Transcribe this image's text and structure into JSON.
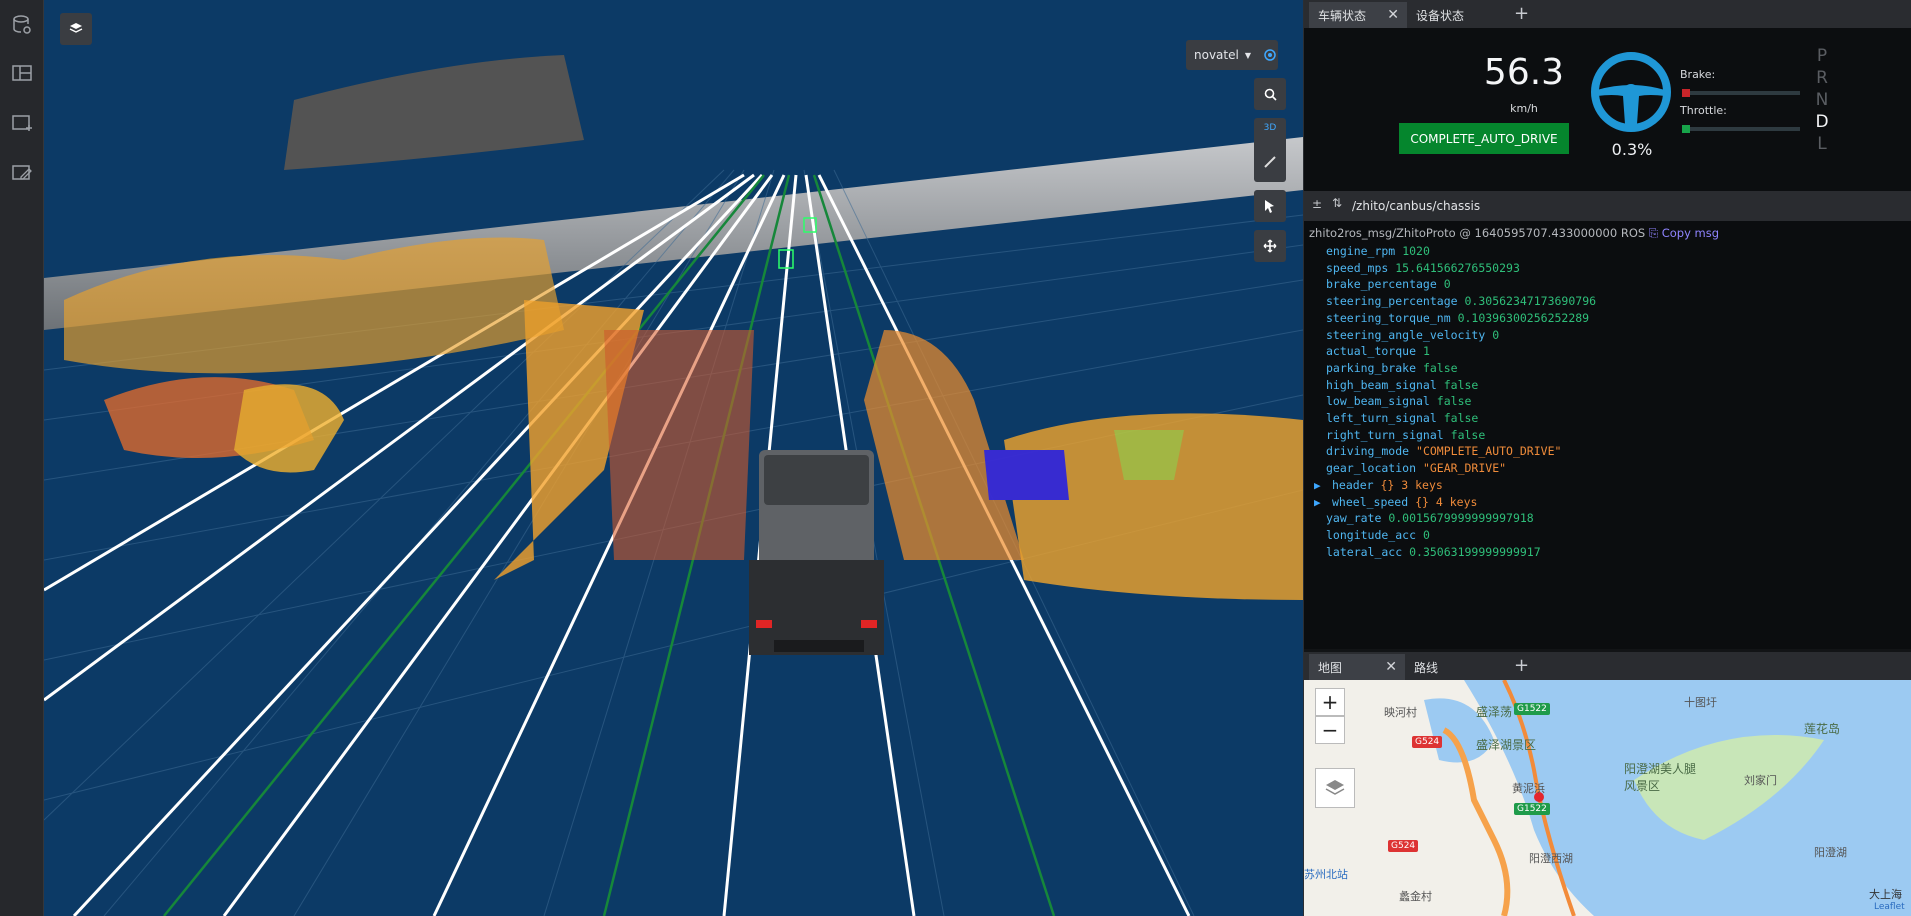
{
  "viewport": {
    "frame_select": "novatel",
    "view_mode_label": "3D"
  },
  "right_top_tabs": [
    {
      "label": "车辆状态"
    },
    {
      "label": "设备状态"
    }
  ],
  "vehicle": {
    "speed": "56.3",
    "speed_unit": "km/h",
    "mode": "COMPLETE_AUTO_DRIVE",
    "steering_pct": "0.3%",
    "brake_label": "Brake:",
    "throttle_label": "Throttle:",
    "brake_level": 0.0,
    "throttle_level": 0.003,
    "gears": [
      "P",
      "R",
      "N",
      "D",
      "L"
    ],
    "active_gear": "D"
  },
  "topic": {
    "path": "/zhito/canbus/chassis",
    "header": "zhito2ros_msg/ZhitoProto @ 1640595707.433000000 ROS",
    "copy_label": "Copy msg"
  },
  "message": [
    {
      "key": "engine_rpm",
      "value": "1020",
      "type": "num"
    },
    {
      "key": "speed_mps",
      "value": "15.641566276550293",
      "type": "num"
    },
    {
      "key": "brake_percentage",
      "value": "0",
      "type": "num"
    },
    {
      "key": "steering_percentage",
      "value": "0.30562347173690796",
      "type": "num"
    },
    {
      "key": "steering_torque_nm",
      "value": "0.10396300256252289",
      "type": "num"
    },
    {
      "key": "steering_angle_velocity",
      "value": "0",
      "type": "num"
    },
    {
      "key": "actual_torque",
      "value": "1",
      "type": "num"
    },
    {
      "key": "parking_brake",
      "value": "false",
      "type": "bool"
    },
    {
      "key": "high_beam_signal",
      "value": "false",
      "type": "bool"
    },
    {
      "key": "low_beam_signal",
      "value": "false",
      "type": "bool"
    },
    {
      "key": "left_turn_signal",
      "value": "false",
      "type": "bool"
    },
    {
      "key": "right_turn_signal",
      "value": "false",
      "type": "bool"
    },
    {
      "key": "driving_mode",
      "value": "\"COMPLETE_AUTO_DRIVE\"",
      "type": "str"
    },
    {
      "key": "gear_location",
      "value": "\"GEAR_DRIVE\"",
      "type": "str"
    },
    {
      "key": "header",
      "value": "{}  3 keys",
      "type": "obj"
    },
    {
      "key": "wheel_speed",
      "value": "{}  4 keys",
      "type": "obj"
    },
    {
      "key": "yaw_rate",
      "value": "0.0015679999999997918",
      "type": "num"
    },
    {
      "key": "longitude_acc",
      "value": "0",
      "type": "num"
    },
    {
      "key": "lateral_acc",
      "value": "0.35063199999999917",
      "type": "num"
    }
  ],
  "bottom_tabs": [
    {
      "label": "地图"
    },
    {
      "label": "路线"
    }
  ],
  "map": {
    "zoom_in": "+",
    "zoom_out": "−",
    "labels": [
      {
        "text": "盛泽荡"
      },
      {
        "text": "盛泽湖景区"
      },
      {
        "text": "映河村"
      },
      {
        "text": "十图圩"
      },
      {
        "text": "阳澄湖美人腿风景区"
      },
      {
        "text": "莲花岛"
      },
      {
        "text": "阳澄西湖"
      },
      {
        "text": "阳澄湖"
      },
      {
        "text": "苏州北站"
      },
      {
        "text": "大上海"
      },
      {
        "text": "黄泥浜"
      },
      {
        "text": "刘家门"
      },
      {
        "text": "蠡金村"
      },
      {
        "text": "Leaflet"
      }
    ],
    "roads": [
      "G524",
      "G1522"
    ]
  },
  "colors": {
    "accent_green": "#05862d",
    "steering_blue": "#1f97d6",
    "viewport_bg": "#0c3a66"
  }
}
